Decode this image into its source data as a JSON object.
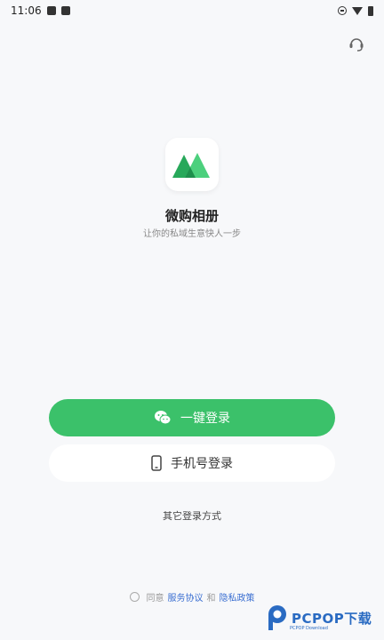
{
  "status_bar": {
    "time": "11:06"
  },
  "app": {
    "name": "微购相册",
    "slogan": "让你的私域生意快人一步"
  },
  "buttons": {
    "wechat_login": "一键登录",
    "phone_login": "手机号登录"
  },
  "other_login": "其它登录方式",
  "agreement": {
    "prefix": "同意",
    "service": "服务协议",
    "and": "和",
    "privacy": "隐私政策"
  },
  "watermark": {
    "text": "PCPOP下载",
    "sub": "PCPOP Download"
  },
  "colors": {
    "primary": "#3bc16a",
    "link": "#3b6fd1",
    "background": "#f7f8fa"
  }
}
